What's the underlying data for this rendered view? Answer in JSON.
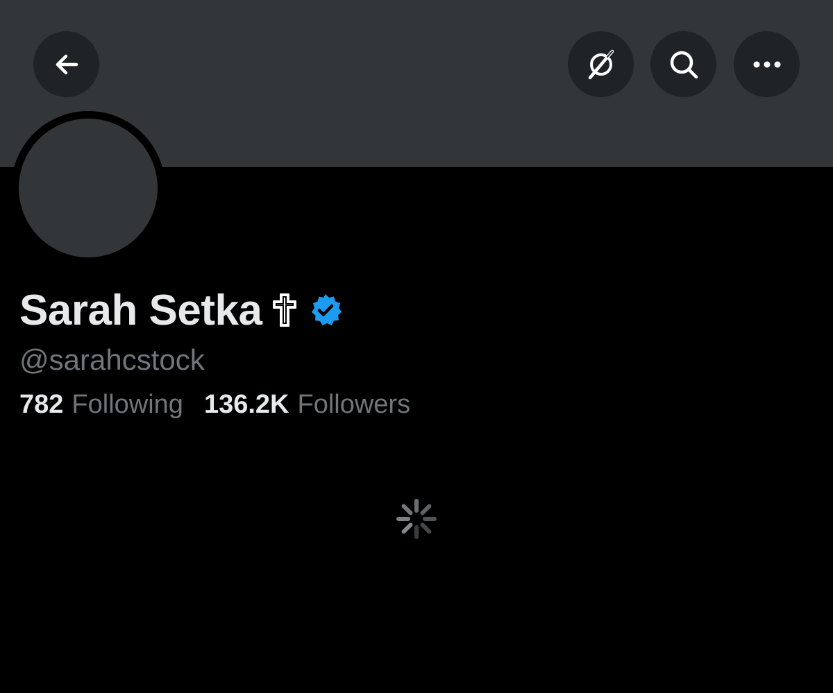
{
  "profile": {
    "display_name": "Sarah Setka",
    "name_emoji": "latin-cross",
    "verified_icon": "verified-badge-icon",
    "handle": "@sarahcstock"
  },
  "stats": {
    "following_count": "782",
    "following_label": "Following",
    "followers_count": "136.2K",
    "followers_label": "Followers"
  },
  "toolbar": {
    "back_icon": "arrow-left-icon",
    "grok_icon": "grok-icon",
    "search_icon": "search-icon",
    "more_icon": "more-horizontal-icon"
  },
  "colors": {
    "background": "#000000",
    "banner": "#333639",
    "button_bg": "#202326",
    "primary_text": "#e7e9ea",
    "secondary_text": "#71767b",
    "verified": "#1d9bf0"
  },
  "loading": {
    "icon": "loading-spinner-icon"
  }
}
